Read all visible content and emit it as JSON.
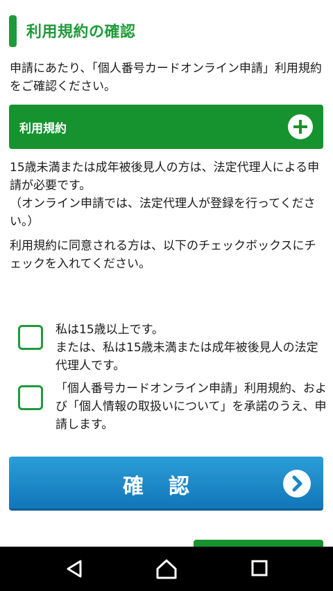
{
  "page": {
    "title": "利用規約の確認",
    "intro": "申請にあたり、「個人番号カードオンライン申請」利用規約をご確認ください。"
  },
  "terms_panel": {
    "label": "利用規約",
    "toggle_icon": "plus-icon"
  },
  "notice": {
    "line1": "15歳未満または成年被後見人の方は、法定代理人による申請が必要です。",
    "line2": "（オンライン申請では、法定代理人が登録を行ってください。）"
  },
  "instruction": "利用規約に同意される方は、以下のチェックボックスにチェックを入れてください。",
  "checkboxes": [
    {
      "text": "私は15歳以上です。\nまたは、私は15歳未満または成年被後見人の法定代理人です。",
      "checked": false
    },
    {
      "text": "「個人番号カードオンライン申請」利用規約、および「個人情報の取扱いについて」を承諾のうえ、申請します。",
      "checked": false
    }
  ],
  "confirm_button": {
    "label": "確認",
    "icon": "chevron-right-icon"
  },
  "system_nav": {
    "back_icon": "back-icon",
    "home_icon": "home-icon",
    "recents_icon": "recents-icon"
  },
  "colors": {
    "brand_green": "#1f9a3a",
    "button_blue": "#1a87c8"
  }
}
